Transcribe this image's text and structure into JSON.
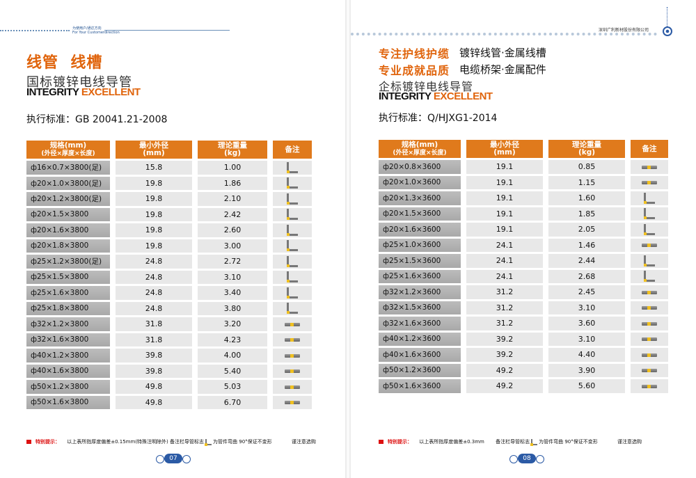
{
  "left": {
    "header_tag_cn": "为使用户/通达方向",
    "header_tag_en": "For Your Customerdirection",
    "title_orange": "线管  线槽",
    "subtitle": "国标镀锌电线导管",
    "integrity": "INTEGRITY",
    "excellent": "EXCELLENT",
    "standard": "执行标准：GB 20041.21-2008",
    "col_spec": "规格(mm)",
    "col_spec_sub": "(外径×厚度×长度)",
    "col_od": "最小外径",
    "col_od_unit": "(mm)",
    "col_wt": "理论重量",
    "col_wt_unit": "(kg)",
    "col_note": "备注",
    "rows": [
      {
        "spec": "ф16×0.7×3800(足)",
        "od": "15.8",
        "wt": "1.00",
        "mark": "L"
      },
      {
        "spec": "ф20×1.0×3800(足)",
        "od": "19.8",
        "wt": "1.86",
        "mark": "L"
      },
      {
        "spec": "ф20×1.2×3800(足)",
        "od": "19.8",
        "wt": "2.10",
        "mark": "L"
      },
      {
        "spec": "ф20×1.5×3800",
        "od": "19.8",
        "wt": "2.42",
        "mark": "L"
      },
      {
        "spec": "ф20×1.6×3800",
        "od": "19.8",
        "wt": "2.60",
        "mark": "L"
      },
      {
        "spec": "ф20×1.8×3800",
        "od": "19.8",
        "wt": "3.00",
        "mark": "L"
      },
      {
        "spec": "ф25×1.2×3800(足)",
        "od": "24.8",
        "wt": "2.72",
        "mark": "L"
      },
      {
        "spec": "ф25×1.5×3800",
        "od": "24.8",
        "wt": "3.10",
        "mark": "L"
      },
      {
        "spec": "ф25×1.6×3800",
        "od": "24.8",
        "wt": "3.40",
        "mark": "L"
      },
      {
        "spec": "ф25×1.8×3800",
        "od": "24.8",
        "wt": "3.80",
        "mark": "L"
      },
      {
        "spec": "ф32×1.2×3800",
        "od": "31.8",
        "wt": "3.20",
        "mark": "S"
      },
      {
        "spec": "ф32×1.6×3800",
        "od": "31.8",
        "wt": "4.23",
        "mark": "S"
      },
      {
        "spec": "ф40×1.2×3800",
        "od": "39.8",
        "wt": "4.00",
        "mark": "S"
      },
      {
        "spec": "ф40×1.6×3800",
        "od": "39.8",
        "wt": "5.40",
        "mark": "S"
      },
      {
        "spec": "ф50×1.2×3800",
        "od": "49.8",
        "wt": "5.03",
        "mark": "S"
      },
      {
        "spec": "ф50×1.6×3800",
        "od": "49.8",
        "wt": "6.70",
        "mark": "S"
      }
    ],
    "foot_label": "特别提示：",
    "foot_text1": "以上表所指厚度偏差±0.15mm(特殊注明除外) 备注栏导管标志",
    "foot_text2": "为管件弯曲 90°保证不变形",
    "foot_text3": "谨注意选购",
    "page_number": "07"
  },
  "right": {
    "header_company": "深圳广利新材股份有限公司",
    "slogan1": "专注护线护缆",
    "slogan1_desc": "镀锌线管·金属线槽",
    "slogan2": "专业成就品质",
    "slogan2_desc": "电缆桥架·金属配件",
    "subtitle": "企标镀锌电线导管",
    "integrity": "INTEGRITY",
    "excellent": "EXCELLENT",
    "standard": "执行标准：Q/HJXG1-2014",
    "col_spec": "规格(mm)",
    "col_spec_sub": "(外径×厚度×长度)",
    "col_od": "最小外径",
    "col_od_unit": "(mm)",
    "col_wt": "理论重量",
    "col_wt_unit": "(kg)",
    "col_note": "备注",
    "rows": [
      {
        "spec": "ф20×0.8×3600",
        "od": "19.1",
        "wt": "0.85",
        "mark": "S"
      },
      {
        "spec": "ф20×1.0×3600",
        "od": "19.1",
        "wt": "1.15",
        "mark": "S"
      },
      {
        "spec": "ф20×1.3×3600",
        "od": "19.1",
        "wt": "1.60",
        "mark": "L"
      },
      {
        "spec": "ф20×1.5×3600",
        "od": "19.1",
        "wt": "1.85",
        "mark": "L"
      },
      {
        "spec": "ф20×1.6×3600",
        "od": "19.1",
        "wt": "2.05",
        "mark": "L"
      },
      {
        "spec": "ф25×1.0×3600",
        "od": "24.1",
        "wt": "1.46",
        "mark": "S"
      },
      {
        "spec": "ф25×1.5×3600",
        "od": "24.1",
        "wt": "2.44",
        "mark": "L"
      },
      {
        "spec": "ф25×1.6×3600",
        "od": "24.1",
        "wt": "2.68",
        "mark": "L"
      },
      {
        "spec": "ф32×1.2×3600",
        "od": "31.2",
        "wt": "2.45",
        "mark": "S"
      },
      {
        "spec": "ф32×1.5×3600",
        "od": "31.2",
        "wt": "3.10",
        "mark": "S"
      },
      {
        "spec": "ф32×1.6×3600",
        "od": "31.2",
        "wt": "3.60",
        "mark": "S"
      },
      {
        "spec": "ф40×1.2×3600",
        "od": "39.2",
        "wt": "3.10",
        "mark": "S"
      },
      {
        "spec": "ф40×1.6×3600",
        "od": "39.2",
        "wt": "4.40",
        "mark": "S"
      },
      {
        "spec": "ф50×1.2×3600",
        "od": "49.2",
        "wt": "3.90",
        "mark": "S"
      },
      {
        "spec": "ф50×1.6×3600",
        "od": "49.2",
        "wt": "5.60",
        "mark": "S"
      }
    ],
    "foot_label": "特别提示：",
    "foot_text1": "以上表所指厚度偏差±0.3mm",
    "foot_text2": "备注栏导管标志",
    "foot_text3": "为管件弯曲 90°保证不变形",
    "foot_text4": "谨注意选购",
    "page_number": "08"
  },
  "colors": {
    "accent": "#e0640c",
    "header_fill": "#e07a1c",
    "blue": "#2b5aa5"
  }
}
